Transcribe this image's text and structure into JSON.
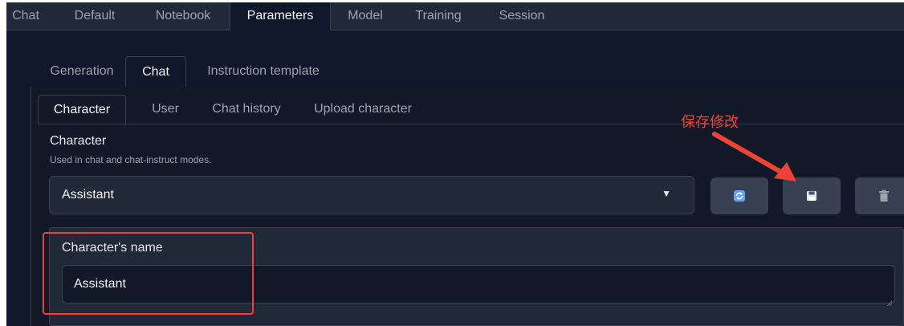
{
  "top_tabs": [
    "Chat",
    "Default",
    "Notebook",
    "Parameters",
    "Model",
    "Training",
    "Session"
  ],
  "top_active": "Parameters",
  "param_tabs": [
    "Generation",
    "Chat",
    "Instruction template"
  ],
  "param_active": "Chat",
  "chat_tabs": [
    "Character",
    "User",
    "Chat history",
    "Upload character"
  ],
  "chat_active": "Character",
  "character": {
    "label": "Character",
    "info": "Used in chat and chat-instruct modes.",
    "selected": "Assistant",
    "buttons": [
      {
        "name": "refresh-icon",
        "label": "refresh"
      },
      {
        "name": "save-icon",
        "label": "save"
      },
      {
        "name": "delete-icon",
        "label": "delete"
      }
    ]
  },
  "name_field": {
    "label": "Character's name",
    "value": "Assistant"
  },
  "annotation": {
    "text": "保存修改",
    "color": "#ef4135"
  },
  "colors": {
    "background": "#0f172a",
    "panel": "#111827",
    "accent_red": "#ef4135"
  }
}
